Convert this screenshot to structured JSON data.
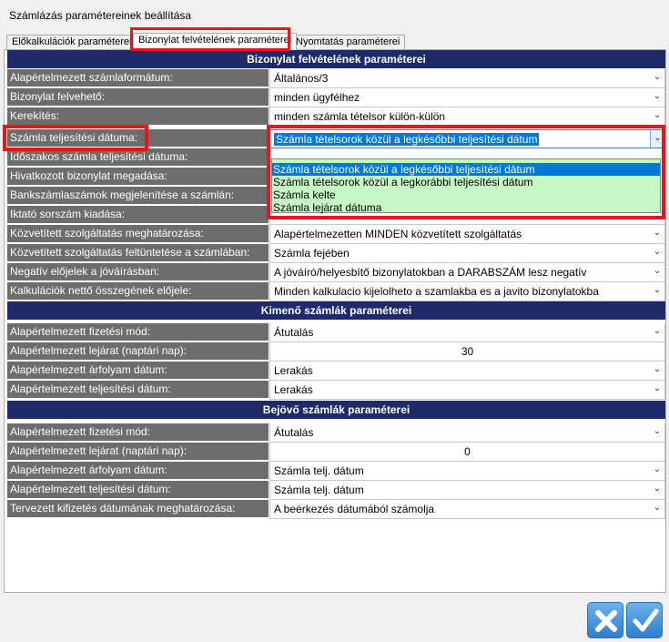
{
  "window": {
    "title": "Számlázás paramétereinek beállítása"
  },
  "tabs": [
    {
      "label": "Előkalkulációk paraméterei"
    },
    {
      "label": "Bizonylat felvételének paraméterei"
    },
    {
      "label": "Nyomtatás paraméterei"
    }
  ],
  "sections": {
    "bizonylat": "Bizonylat felvételének paraméterei",
    "kimeno": "Kimenő számlák paraméterei",
    "bejovo": "Bejövő számlák paraméterei"
  },
  "bizonylat_rows": [
    {
      "label": "Alapértelmezett számlaformátum:",
      "value": "Általános/3"
    },
    {
      "label": "Bizonylat felvehető:",
      "value": "minden ügyfélhez"
    },
    {
      "label": "Kerekítés:",
      "value": "minden számla tételsor külön-külön"
    },
    {
      "label": "Számla teljesítési dátuma:",
      "value": "Számla tételsorok közül a legkésőbbi teljesítési dátum"
    },
    {
      "label": "Időszakos számla teljesítési dátuma:",
      "value": ""
    },
    {
      "label": "Hivatkozott bizonylat megadása:",
      "value": ""
    },
    {
      "label": "Bankszámlaszámok megjelenítése a számlán:",
      "value": ""
    },
    {
      "label": "Iktató sorszám kiadása:",
      "value": ""
    },
    {
      "label": "Közvetített szolgáltatás meghatározása:",
      "value": "Alapértelmezetten MINDEN közvetített szolgáltatás"
    },
    {
      "label": "Közvetített szolgáltatás feltüntetése a számlában:",
      "value": "Számla fejében"
    },
    {
      "label": "Negatív előjelek a jóváírásban:",
      "value": "A jóváíró/helyesbítő bizonylatokban a DARABSZÁM lesz negatív"
    },
    {
      "label": "Kalkulációk nettő összegének előjele:",
      "value": "Minden kalkulacio kijelolheto a szamlakba es a javito bizonylatokba"
    }
  ],
  "dropdown_options": [
    "Számla tételsorok közül a legkésőbbi teljesítési dátum",
    "Számla tételsorok közül a legkorábbi teljesítési dátum",
    "Számla kelte",
    "Számla lejárat dátuma"
  ],
  "kimeno_rows": [
    {
      "label": "Alapértelmezett fizetési mód:",
      "value": "Átutalás"
    },
    {
      "label": "Alapértelmezett lejárat (naptári nap):",
      "value": "30"
    },
    {
      "label": "Alapértelmezett árfolyam dátum:",
      "value": "Lerakás"
    },
    {
      "label": "Alapértelmezett teljesítési dátum:",
      "value": "Lerakás"
    }
  ],
  "bejovo_rows": [
    {
      "label": "Alapértelmezett fizetési mód:",
      "value": "Átutalás"
    },
    {
      "label": "Alapértelmezett lejárat (naptári nap):",
      "value": "0"
    },
    {
      "label": "Alapértelmezett árfolyam dátum:",
      "value": "Számla telj. dátum"
    },
    {
      "label": "Alapértelmezett teljesítési dátum:",
      "value": "Számla telj. dátum"
    },
    {
      "label": "Tervezett kifizetés dátumának meghatározása:",
      "value": "A beérkezés dátumából számolja"
    }
  ],
  "icons": {
    "dropdown": "chevron-down-icon",
    "cancel": "close-icon",
    "ok": "checkmark-icon"
  },
  "colors": {
    "section_header": "#1f2a6b",
    "label_bg": "#6d6d6d",
    "dropdown_bg": "#c6f8c6",
    "selection": "#0078d7",
    "highlight": "#e8161c"
  }
}
